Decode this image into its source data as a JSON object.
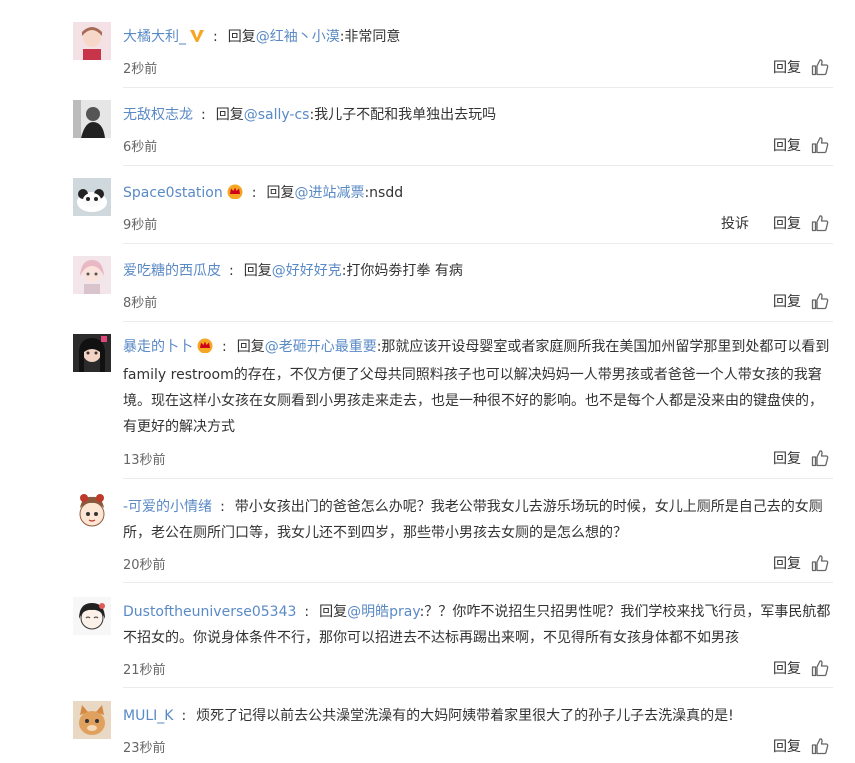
{
  "labels": {
    "reply_prefix": "回复",
    "reply_button": "回复",
    "report_button": "投诉"
  },
  "colors": {
    "username": "#5a8ac6",
    "text": "#333333",
    "time": "#666666",
    "vip_badge": "#f5a623",
    "crown_badge": "#f5a623"
  },
  "comments": [
    {
      "user": "大橘大利_",
      "badge": "v-badge-icon",
      "mention": "@红袖丶小漠",
      "text": ":非常同意",
      "time": "2秒前",
      "report": ""
    },
    {
      "user": "无敌权志龙",
      "badge": "",
      "mention": "@sally-cs",
      "text": ":我儿子不配和我单独出去玩吗",
      "time": "6秒前",
      "report": ""
    },
    {
      "user": "Space0station",
      "badge": "crown-badge-icon",
      "mention": "@进站减票",
      "text": ":nsdd",
      "time": "9秒前",
      "report": "投诉"
    },
    {
      "user": "爱吃糖的西瓜皮",
      "badge": "",
      "mention": "@好好好克",
      "text": ":打你妈劵打拳 有病",
      "time": "8秒前",
      "report": ""
    },
    {
      "user": "暴走的卜卜",
      "badge": "crown-badge-icon",
      "mention": "@老砸开心最重要",
      "text": ":那就应该开设母婴室或者家庭厕所我在美国加州留学那里到处都可以看到family restroom的存在，不仅方便了父母共同照料孩子也可以解决妈妈一人带男孩或者爸爸一个人带女孩的我窘境。现在这样小女孩在女厕看到小男孩走来走去，也是一种很不好的影响。也不是每个人都是没来由的键盘侠的，有更好的解决方式",
      "time": "13秒前",
      "report": ""
    },
    {
      "user": "-可爱的小情绪",
      "badge": "",
      "mention": "",
      "text": "带小女孩出门的爸爸怎么办呢？我老公带我女儿去游乐场玩的时候，女儿上厕所是自己去的女厕所，老公在厕所门口等，我女儿还不到四岁，那些带小男孩去女厕的是怎么想的？",
      "time": "20秒前",
      "report": ""
    },
    {
      "user": "Dustoftheuniverse05343",
      "badge": "",
      "mention": "@明皓pray",
      "text": ":？？你咋不说招生只招男性呢？我们学校来找飞行员，军事民航都不招女的。你说身体条件不行，那你可以招进去不达标再踢出来啊，不见得所有女孩身体都不如男孩",
      "time": "21秒前",
      "report": ""
    },
    {
      "user": "MULI_K",
      "badge": "",
      "mention": "",
      "text": "烦死了记得以前去公共澡堂洗澡有的大妈阿姨带着家里很大了的孙子儿子去洗澡真的是!",
      "time": "23秒前",
      "report": ""
    }
  ]
}
